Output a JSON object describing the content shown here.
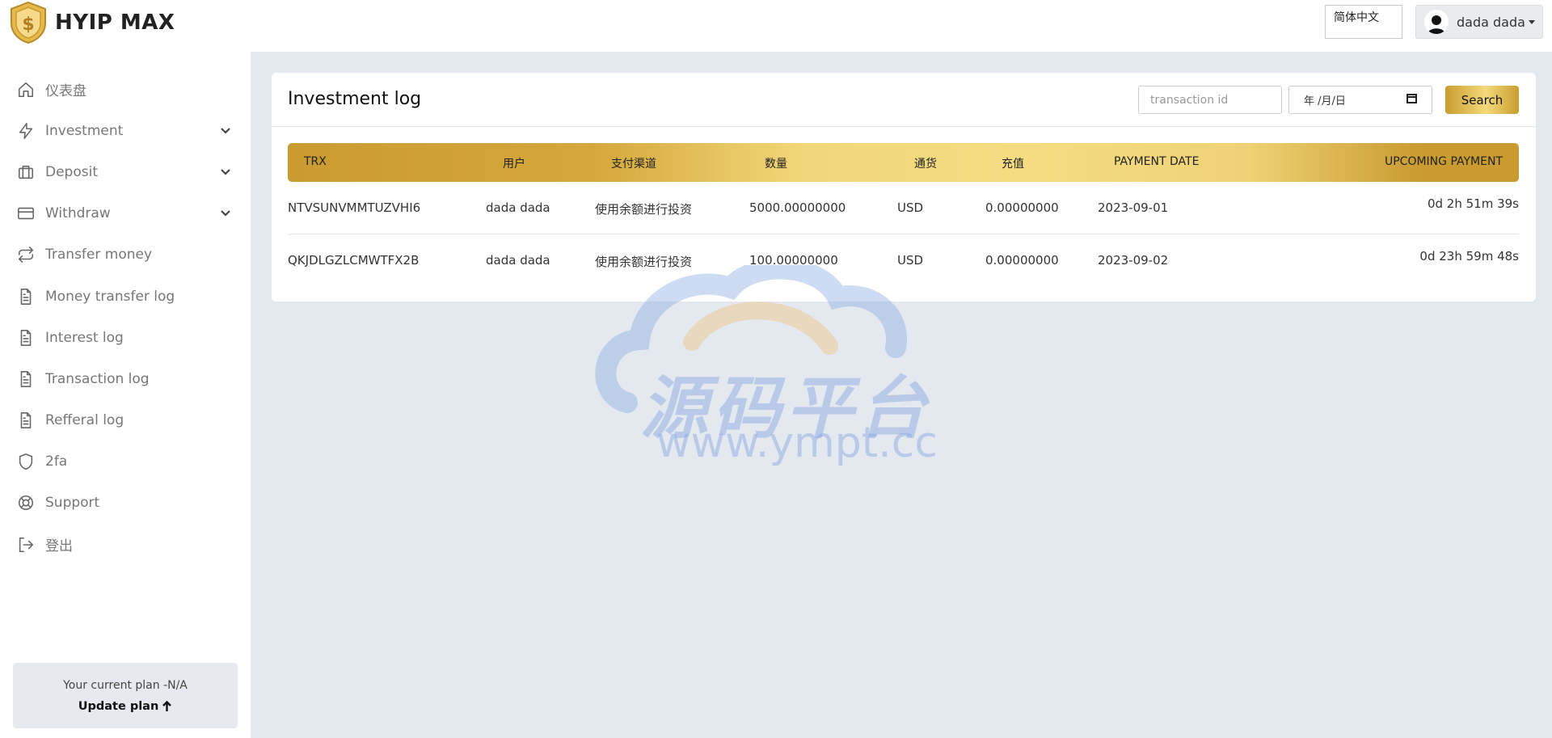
{
  "brand": {
    "name": "HYIP MAX"
  },
  "sidebar": {
    "items": [
      {
        "label": "仪表盘",
        "icon": "home-icon",
        "expandable": false
      },
      {
        "label": "Investment",
        "icon": "lightning-icon",
        "expandable": true
      },
      {
        "label": "Deposit",
        "icon": "briefcase-icon",
        "expandable": true
      },
      {
        "label": "Withdraw",
        "icon": "credit-card-icon",
        "expandable": true
      },
      {
        "label": "Transfer money",
        "icon": "transfer-arrows-icon",
        "expandable": false
      },
      {
        "label": "Money transfer log",
        "icon": "document-icon",
        "expandable": false
      },
      {
        "label": "Interest log",
        "icon": "document-icon",
        "expandable": false
      },
      {
        "label": "Transaction log",
        "icon": "document-icon",
        "expandable": false
      },
      {
        "label": "Refferal log",
        "icon": "document-icon",
        "expandable": false
      },
      {
        "label": "2fa",
        "icon": "shield-icon",
        "expandable": false
      },
      {
        "label": "Support",
        "icon": "lifebuoy-icon",
        "expandable": false
      },
      {
        "label": "登出",
        "icon": "logout-icon",
        "expandable": false
      }
    ],
    "plan": {
      "text": "Your current plan -N/A",
      "link": "Update plan"
    }
  },
  "topbar": {
    "language": "简体中文",
    "user_name": "dada dada"
  },
  "page": {
    "title": "Investment log",
    "search": {
      "txn_placeholder": "transaction id",
      "date_placeholder": "年 /月/日",
      "button": "Search"
    },
    "table": {
      "columns": [
        "TRX",
        "用户",
        "支付渠道",
        "数量",
        "通货",
        "充值",
        "PAYMENT DATE",
        "UPCOMING PAYMENT"
      ],
      "rows": [
        [
          "NTVSUNVMMTUZVHI6",
          "dada dada",
          "使用余额进行投资",
          "5000.00000000",
          "USD",
          "0.00000000",
          "2023-09-01",
          "0d 2h 51m 39s"
        ],
        [
          "QKJDLGZLCMWTFX2B",
          "dada dada",
          "使用余额进行投资",
          "100.00000000",
          "USD",
          "0.00000000",
          "2023-09-02",
          "0d 23h 59m 48s"
        ]
      ]
    }
  },
  "watermark": {
    "cn": "源码平台",
    "url": "www.ympt.cc"
  },
  "colors": {
    "gold_dark": "#c99b30",
    "gold_light": "#f5dc82",
    "bg": "#e4e9ef"
  }
}
